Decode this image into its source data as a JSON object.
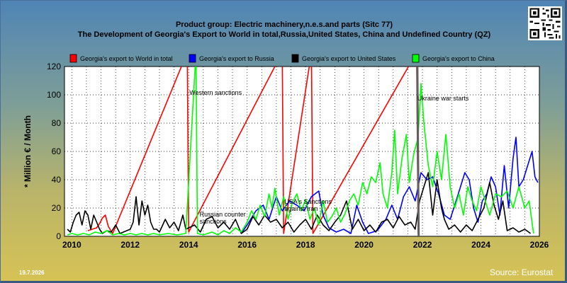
{
  "header": {
    "title_line1": "Product group: Electric machinery,n.e.s.and parts (Sitc 77)",
    "title_line2": "The Development of Georgia's Export to World in total,Russia,United States, China and Undefined Country (QZ)"
  },
  "footer": {
    "date": "19.7.2026",
    "source": "Source: Eurostat"
  },
  "chart_data": {
    "type": "line",
    "title": "The Development of Georgia's Export to World in total,Russia,United States, China and Undefined Country (QZ)",
    "ylabel": "* Million € / Month",
    "xlabel": "",
    "xlim": [
      2009.75,
      2026.0
    ],
    "ylim": [
      0,
      120
    ],
    "x_ticks": [
      2010,
      2012,
      2014,
      2016,
      2018,
      2020,
      2022,
      2024,
      2026
    ],
    "y_ticks": [
      0,
      20,
      40,
      60,
      80,
      100,
      120
    ],
    "grid": true,
    "legend_position": "top",
    "series": [
      {
        "name": "Georgia's export to World in total",
        "color": "#ff0000",
        "points": [
          [
            2010.55,
            4
          ],
          [
            2010.7,
            5
          ],
          [
            2010.85,
            6
          ],
          [
            2010.95,
            9
          ],
          [
            2011.05,
            13
          ],
          [
            2011.15,
            15
          ],
          [
            2011.25,
            7
          ],
          [
            2011.4,
            2
          ],
          [
            2013.95,
            130
          ],
          [
            2014.0,
            3
          ],
          [
            2017.2,
            130
          ],
          [
            2017.25,
            2
          ],
          [
            2018.2,
            130
          ],
          [
            2018.25,
            2
          ],
          [
            2021.8,
            130
          ],
          [
            2021.85,
            2
          ]
        ]
      },
      {
        "name": "Georgia's export to Russia",
        "color": "#0000ff",
        "points": [
          [
            2015.8,
            2
          ],
          [
            2016.0,
            8
          ],
          [
            2016.3,
            18
          ],
          [
            2016.55,
            22
          ],
          [
            2016.75,
            12
          ],
          [
            2017.0,
            28
          ],
          [
            2017.2,
            18
          ],
          [
            2017.45,
            25
          ],
          [
            2017.7,
            22
          ],
          [
            2017.95,
            18
          ],
          [
            2018.2,
            28
          ],
          [
            2018.45,
            32
          ],
          [
            2018.6,
            15
          ],
          [
            2018.8,
            6
          ],
          [
            2019.05,
            3
          ],
          [
            2019.3,
            5
          ],
          [
            2019.55,
            2
          ],
          [
            2019.75,
            22
          ],
          [
            2019.95,
            10
          ],
          [
            2020.15,
            2
          ],
          [
            2020.45,
            4
          ],
          [
            2020.75,
            12
          ],
          [
            2020.95,
            22
          ],
          [
            2021.15,
            12
          ],
          [
            2021.35,
            28
          ],
          [
            2021.55,
            35
          ],
          [
            2021.75,
            25
          ],
          [
            2021.95,
            45
          ],
          [
            2022.15,
            40
          ],
          [
            2022.35,
            42
          ],
          [
            2022.55,
            30
          ],
          [
            2022.75,
            15
          ],
          [
            2022.95,
            12
          ],
          [
            2023.15,
            25
          ],
          [
            2023.3,
            35
          ],
          [
            2023.45,
            45
          ],
          [
            2023.6,
            40
          ],
          [
            2023.75,
            20
          ],
          [
            2023.9,
            10
          ],
          [
            2024.05,
            25
          ],
          [
            2024.2,
            30
          ],
          [
            2024.35,
            42
          ],
          [
            2024.5,
            35
          ],
          [
            2024.65,
            15
          ],
          [
            2024.8,
            50
          ],
          [
            2024.95,
            20
          ],
          [
            2025.1,
            55
          ],
          [
            2025.2,
            70
          ],
          [
            2025.3,
            35
          ],
          [
            2025.45,
            40
          ],
          [
            2025.6,
            50
          ],
          [
            2025.75,
            60
          ],
          [
            2025.85,
            42
          ],
          [
            2025.95,
            38
          ]
        ]
      },
      {
        "name": "Georgia's export to United States",
        "color": "#000000",
        "points": [
          [
            2009.85,
            5
          ],
          [
            2009.95,
            3
          ],
          [
            2010.05,
            10
          ],
          [
            2010.15,
            15
          ],
          [
            2010.25,
            17
          ],
          [
            2010.35,
            8
          ],
          [
            2010.45,
            18
          ],
          [
            2010.55,
            15
          ],
          [
            2010.65,
            5
          ],
          [
            2010.75,
            15
          ],
          [
            2010.85,
            10
          ],
          [
            2010.95,
            5
          ],
          [
            2011.05,
            2
          ],
          [
            2011.2,
            4
          ],
          [
            2011.35,
            3
          ],
          [
            2011.5,
            8
          ],
          [
            2011.65,
            2
          ],
          [
            2012.0,
            5
          ],
          [
            2012.1,
            10
          ],
          [
            2012.2,
            28
          ],
          [
            2012.3,
            8
          ],
          [
            2012.4,
            25
          ],
          [
            2012.5,
            15
          ],
          [
            2012.6,
            22
          ],
          [
            2012.7,
            10
          ],
          [
            2012.8,
            5
          ],
          [
            2012.9,
            5
          ],
          [
            2013.0,
            3
          ],
          [
            2013.2,
            12
          ],
          [
            2013.35,
            6
          ],
          [
            2013.5,
            10
          ],
          [
            2013.65,
            4
          ],
          [
            2013.8,
            15
          ],
          [
            2013.9,
            5
          ],
          [
            2014.2,
            8
          ],
          [
            2014.4,
            3
          ],
          [
            2014.6,
            12
          ],
          [
            2014.8,
            14
          ],
          [
            2015.0,
            6
          ],
          [
            2015.2,
            10
          ],
          [
            2015.4,
            5
          ],
          [
            2015.6,
            12
          ],
          [
            2015.8,
            2
          ],
          [
            2016.0,
            5
          ],
          [
            2016.2,
            14
          ],
          [
            2016.4,
            8
          ],
          [
            2016.6,
            15
          ],
          [
            2016.8,
            10
          ],
          [
            2017.0,
            12
          ],
          [
            2017.2,
            6
          ],
          [
            2017.4,
            10
          ],
          [
            2017.6,
            3
          ],
          [
            2017.8,
            8
          ],
          [
            2018.0,
            12
          ],
          [
            2018.2,
            5
          ],
          [
            2018.4,
            15
          ],
          [
            2018.6,
            8
          ],
          [
            2018.8,
            4
          ],
          [
            2019.0,
            10
          ],
          [
            2019.2,
            15
          ],
          [
            2019.4,
            25
          ],
          [
            2019.6,
            5
          ],
          [
            2019.8,
            12
          ],
          [
            2020.0,
            4
          ],
          [
            2020.2,
            8
          ],
          [
            2020.4,
            3
          ],
          [
            2020.6,
            10
          ],
          [
            2020.8,
            12
          ],
          [
            2021.0,
            6
          ],
          [
            2021.2,
            14
          ],
          [
            2021.4,
            8
          ],
          [
            2021.6,
            10
          ],
          [
            2021.75,
            5
          ],
          [
            2021.9,
            25
          ],
          [
            2022.05,
            35
          ],
          [
            2022.2,
            45
          ],
          [
            2022.35,
            15
          ],
          [
            2022.5,
            40
          ],
          [
            2022.65,
            20
          ],
          [
            2022.75,
            12
          ],
          [
            2022.9,
            5
          ],
          [
            2023.1,
            8
          ],
          [
            2023.3,
            3
          ],
          [
            2023.5,
            8
          ],
          [
            2023.7,
            4
          ],
          [
            2023.9,
            12
          ],
          [
            2024.1,
            20
          ],
          [
            2024.3,
            38
          ],
          [
            2024.45,
            22
          ],
          [
            2024.6,
            12
          ],
          [
            2024.75,
            25
          ],
          [
            2024.9,
            4
          ],
          [
            2025.1,
            6
          ],
          [
            2025.3,
            3
          ],
          [
            2025.5,
            5
          ],
          [
            2025.7,
            2
          ]
        ]
      },
      {
        "name": "Georgia's export to China",
        "color": "#00ff00",
        "points": [
          [
            2009.85,
            1
          ],
          [
            2010.0,
            2
          ],
          [
            2010.2,
            1
          ],
          [
            2010.4,
            2
          ],
          [
            2010.6,
            1
          ],
          [
            2010.8,
            3
          ],
          [
            2011.0,
            2
          ],
          [
            2011.2,
            4
          ],
          [
            2011.4,
            1
          ],
          [
            2011.6,
            2
          ],
          [
            2011.8,
            1
          ],
          [
            2012.0,
            2
          ],
          [
            2012.2,
            1
          ],
          [
            2012.4,
            2
          ],
          [
            2012.6,
            1
          ],
          [
            2012.8,
            2
          ],
          [
            2013.0,
            1
          ],
          [
            2013.3,
            2
          ],
          [
            2013.6,
            1
          ],
          [
            2013.9,
            2
          ],
          [
            2014.25,
            130
          ],
          [
            2014.3,
            2
          ],
          [
            2014.5,
            1
          ],
          [
            2014.8,
            3
          ],
          [
            2015.0,
            1
          ],
          [
            2015.2,
            4
          ],
          [
            2015.4,
            2
          ],
          [
            2015.6,
            6
          ],
          [
            2015.8,
            3
          ],
          [
            2016.0,
            10
          ],
          [
            2016.15,
            18
          ],
          [
            2016.3,
            12
          ],
          [
            2016.45,
            22
          ],
          [
            2016.6,
            14
          ],
          [
            2016.75,
            30
          ],
          [
            2016.85,
            20
          ],
          [
            2016.95,
            34
          ],
          [
            2017.1,
            15
          ],
          [
            2017.25,
            28
          ],
          [
            2017.4,
            12
          ],
          [
            2017.55,
            24
          ],
          [
            2017.7,
            30
          ],
          [
            2017.85,
            18
          ],
          [
            2018.0,
            26
          ],
          [
            2018.15,
            12
          ],
          [
            2018.3,
            20
          ],
          [
            2018.45,
            8
          ],
          [
            2018.6,
            25
          ],
          [
            2018.75,
            10
          ],
          [
            2018.9,
            14
          ],
          [
            2019.05,
            20
          ],
          [
            2019.2,
            10
          ],
          [
            2019.35,
            16
          ],
          [
            2019.5,
            25
          ],
          [
            2019.65,
            30
          ],
          [
            2019.8,
            22
          ],
          [
            2019.95,
            38
          ],
          [
            2020.1,
            30
          ],
          [
            2020.25,
            42
          ],
          [
            2020.4,
            38
          ],
          [
            2020.55,
            52
          ],
          [
            2020.65,
            30
          ],
          [
            2020.8,
            20
          ],
          [
            2020.95,
            45
          ],
          [
            2021.05,
            75
          ],
          [
            2021.15,
            30
          ],
          [
            2021.3,
            55
          ],
          [
            2021.45,
            72
          ],
          [
            2021.55,
            38
          ],
          [
            2021.7,
            58
          ],
          [
            2021.85,
            70
          ],
          [
            2021.95,
            108
          ],
          [
            2022.05,
            80
          ],
          [
            2022.2,
            50
          ],
          [
            2022.35,
            35
          ],
          [
            2022.5,
            60
          ],
          [
            2022.65,
            40
          ],
          [
            2022.8,
            72
          ],
          [
            2022.95,
            35
          ],
          [
            2023.1,
            20
          ],
          [
            2023.25,
            30
          ],
          [
            2023.4,
            15
          ],
          [
            2023.55,
            35
          ],
          [
            2023.7,
            25
          ],
          [
            2023.85,
            18
          ],
          [
            2024.0,
            35
          ],
          [
            2024.15,
            25
          ],
          [
            2024.3,
            15
          ],
          [
            2024.5,
            30
          ],
          [
            2024.7,
            28
          ],
          [
            2024.9,
            32
          ],
          [
            2025.1,
            20
          ],
          [
            2025.3,
            35
          ],
          [
            2025.5,
            20
          ],
          [
            2025.65,
            25
          ],
          [
            2025.8,
            2
          ]
        ]
      },
      {
        "name": "Undefined Country (QZ)",
        "color": "#606060",
        "points": [
          [
            2021.82,
            130
          ],
          [
            2021.87,
            0
          ]
        ]
      }
    ],
    "annotations": [
      {
        "text": "Western sanctions",
        "x": 2014.0,
        "y": 100
      },
      {
        "text": "Russian counter",
        "x": 2014.35,
        "y": 14
      },
      {
        "text": "sanctions",
        "x": 2014.35,
        "y": 9
      },
      {
        "text": "USA's Sanctions",
        "x": 2017.25,
        "y": 23
      },
      {
        "text": "against Iran",
        "x": 2017.25,
        "y": 18
      },
      {
        "text": "Ukraine war starts",
        "x": 2021.8,
        "y": 96
      }
    ]
  }
}
